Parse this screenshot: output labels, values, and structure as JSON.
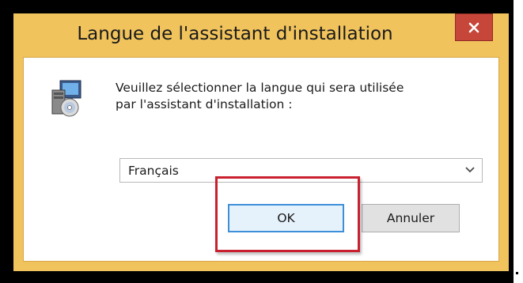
{
  "window": {
    "title": "Langue de l'assistant d'installation",
    "close_glyph": "×"
  },
  "icons": {
    "setup": "setup-installer-icon",
    "close": "close-icon",
    "dropdown": "chevron-down-icon"
  },
  "dialog": {
    "prompt_line1": "Veuillez sélectionner la langue qui sera utilisée",
    "prompt_line2": "par l'assistant d'installation :",
    "language_select": {
      "selected": "Français"
    },
    "buttons": {
      "ok_label": "OK",
      "cancel_label": "Annuler"
    }
  },
  "colors": {
    "titlebar": "#f0c35d",
    "close_button": "#c7463a",
    "highlight": "#c8202e",
    "focus_border": "#3c8fd8"
  }
}
